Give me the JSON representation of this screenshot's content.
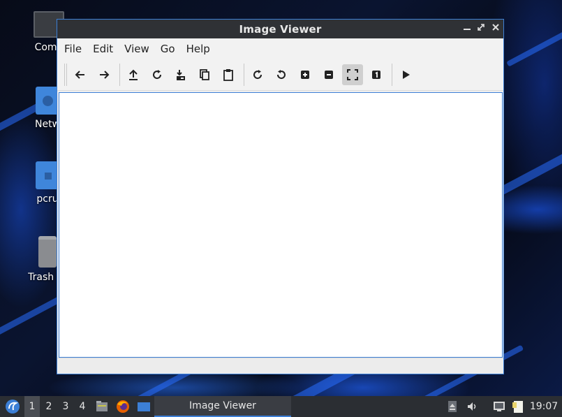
{
  "desktop": {
    "icons": [
      {
        "label": "Comp",
        "icon": "computer-icon"
      },
      {
        "label": "Netw",
        "icon": "network-folder-icon"
      },
      {
        "label": "pcru",
        "icon": "home-folder-icon"
      },
      {
        "label": "Trash (E",
        "icon": "trash-icon"
      }
    ]
  },
  "window": {
    "title": "Image Viewer",
    "controls": [
      "minimize-icon",
      "maximize-icon",
      "close-icon"
    ],
    "menu": [
      "File",
      "Edit",
      "View",
      "Go",
      "Help"
    ],
    "toolbar": [
      "back-arrow-icon",
      "forward-arrow-icon",
      "open-upload-icon",
      "reload-icon",
      "save-icon",
      "copy-icon",
      "paste-icon",
      "rotate-clockwise-icon",
      "rotate-counterclockwise-icon",
      "zoom-in-icon",
      "zoom-out-icon",
      "fit-to-window-icon",
      "original-size-icon",
      "slideshow-play-icon"
    ],
    "active_tool": "fit-to-window-icon"
  },
  "taskbar": {
    "workspaces": [
      "1",
      "2",
      "3",
      "4"
    ],
    "active_workspace": "1",
    "task": "Image Viewer",
    "clock": "19:07"
  },
  "colors": {
    "accent": "#3c7fd6",
    "titlebar": "#2f3135",
    "taskbar": "#2b2e33",
    "window_bg": "#efefef"
  }
}
